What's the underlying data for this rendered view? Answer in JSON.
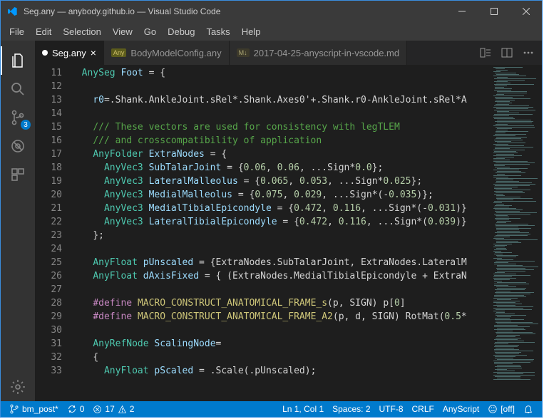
{
  "title": "Seg.any — anybody.github.io — Visual Studio Code",
  "menus": [
    "File",
    "Edit",
    "Selection",
    "View",
    "Go",
    "Debug",
    "Tasks",
    "Help"
  ],
  "tabs": [
    {
      "label": "Seg.any",
      "active": true,
      "dirty": true
    },
    {
      "label": "BodyModelConfig.any",
      "active": false
    },
    {
      "label": "2017-04-25-anyscript-in-vscode.md",
      "active": false
    }
  ],
  "scm_badge": "3",
  "lines": {
    "start": 11,
    "end": 33
  },
  "code": {
    "l11": {
      "t1": "AnySeg",
      "v1": "Foot",
      "r": " = {"
    },
    "l13": {
      "v1": "r0",
      "r": "=.Shank.AnkleJoint.sRel*.Shank.Axes0'+.Shank.r0-AnkleJoint.sRel*A"
    },
    "l15": "/// These vectors are used for consistency with legTLEM",
    "l16": "/// and crosscompatibility of application",
    "l17": {
      "t1": "AnyFolder",
      "v1": "ExtraNodes",
      "r": " = {"
    },
    "l18": {
      "t1": "AnyVec3",
      "v1": "SubTalarJoint",
      "mid": " = {",
      "n1": "0.06",
      "n2": "0.06",
      "exp": "...Sign*",
      "n3": "0.0",
      "end": "};"
    },
    "l19": {
      "t1": "AnyVec3",
      "v1": "LateralMalleolus",
      "mid": " = {",
      "n1": "0.065",
      "n2": "0.053",
      "exp": "...Sign*",
      "n3": "0.025",
      "end": "};"
    },
    "l20": {
      "t1": "AnyVec3",
      "v1": "MedialMalleolus",
      "mid": " = {",
      "n1": "0.075",
      "n2": "0.029",
      "exp": "...Sign*(-",
      "n3": "0.035",
      "end": ")};"
    },
    "l21": {
      "t1": "AnyVec3",
      "v1": "MedialTibialEpicondyle",
      "mid": " = {",
      "n1": "0.472",
      "n2": "0.116",
      "exp": "...Sign*(-",
      "n3": "0.031",
      "end": ")}"
    },
    "l22": {
      "t1": "AnyVec3",
      "v1": "LateralTibialEpicondyle",
      "mid": " = {",
      "n1": "0.472",
      "n2": "0.116",
      "exp": "...Sign*(",
      "n3": "0.039",
      "end": ")}"
    },
    "l23": "};",
    "l25": {
      "t1": "AnyFloat",
      "v1": "pUnscaled",
      "r": " = {ExtraNodes.SubTalarJoint, ExtraNodes.LateralM"
    },
    "l26": {
      "t1": "AnyFloat",
      "v1": "dAxisFixed",
      "r": " = { (ExtraNodes.MedialTibialEpicondyle + ExtraN"
    },
    "l28": {
      "d": "#define",
      "m": "MACRO_CONSTRUCT_ANATOMICAL_FRAME_s",
      "p": "(p, SIGN) p[",
      "n": "0",
      "end": "]"
    },
    "l29": {
      "d": "#define",
      "m": "MACRO_CONSTRUCT_ANATOMICAL_FRAME_A2",
      "p": "(p, d, SIGN) RotMat(",
      "n": "0.5",
      "end": "*"
    },
    "l31": {
      "t1": "AnyRefNode",
      "v1": "ScalingNode",
      "r": "="
    },
    "l32": "{",
    "l33": {
      "t1": "AnyFloat",
      "v1": "pScaled",
      "r": " = .Scale(.pUnscaled);"
    }
  },
  "status": {
    "branch": "bm_post*",
    "sync": "0",
    "errors": "17",
    "warnings": "2",
    "pos": "Ln 1, Col 1",
    "spaces": "Spaces: 2",
    "encoding": "UTF-8",
    "eol": "CRLF",
    "lang": "AnyScript",
    "feedback": "[off]"
  }
}
